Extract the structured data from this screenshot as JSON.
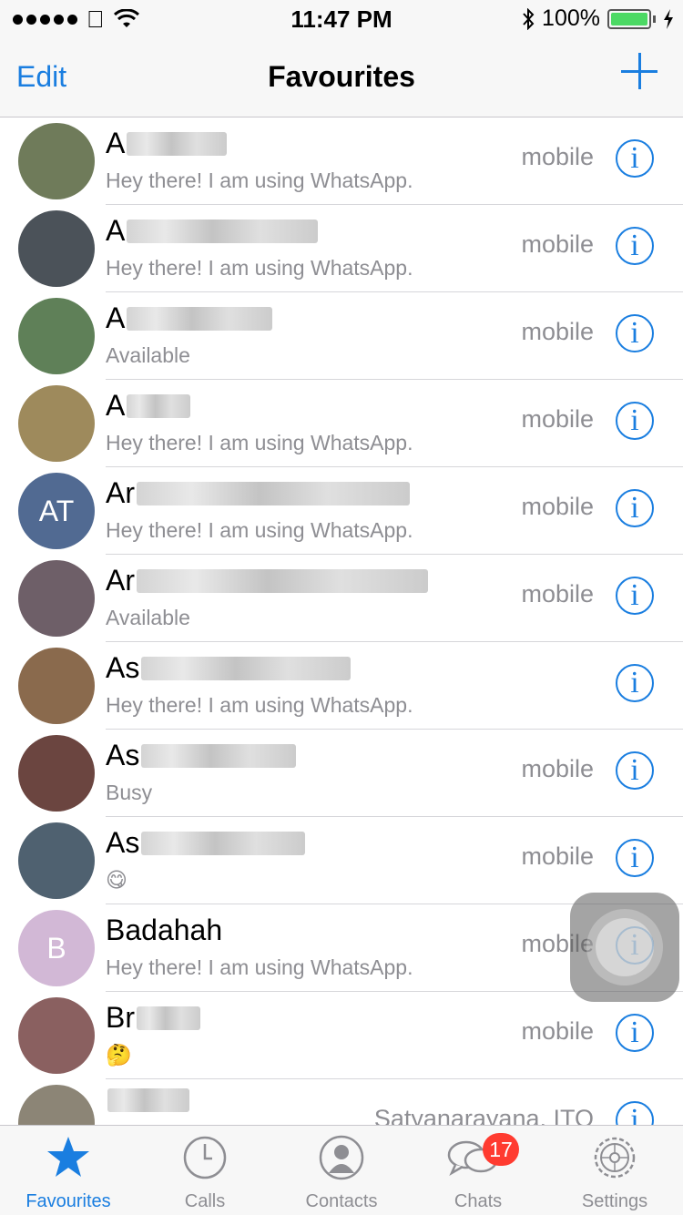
{
  "status_bar": {
    "time": "11:47 PM",
    "battery": "100%",
    "battery_level": 1.0,
    "signal_bars": 5
  },
  "nav": {
    "edit": "Edit",
    "title": "Favourites"
  },
  "contacts": [
    {
      "name": "A",
      "status": "Hey there! I am using WhatsApp.",
      "label": "mobile",
      "avatar_color": "#6f7b5a"
    },
    {
      "name": "A",
      "status": "Hey there! I am using WhatsApp.",
      "label": "mobile",
      "avatar_color": "#4b5259"
    },
    {
      "name": "A",
      "status": "Available",
      "label": "mobile",
      "avatar_color": "#5f8058"
    },
    {
      "name": "A",
      "status": "Hey there! I am using WhatsApp.",
      "label": "mobile",
      "avatar_color": "#9e8a5c"
    },
    {
      "name": "Ar",
      "status": "Hey there! I am using WhatsApp.",
      "label": "mobile",
      "avatar_text": "AT",
      "avatar_color": "#516a92"
    },
    {
      "name": "Ar",
      "status": "Available",
      "label": "mobile",
      "avatar_color": "#6e5f68"
    },
    {
      "name": "As",
      "status": "Hey there! I am using WhatsApp.",
      "label": "",
      "avatar_color": "#8a6a4d"
    },
    {
      "name": "As",
      "status": "Busy",
      "label": "mobile",
      "avatar_color": "#6b4540"
    },
    {
      "name": "As",
      "status": "😋",
      "label": "mobile",
      "avatar_color": "#4f6170"
    },
    {
      "name": "Badahah",
      "status": "Hey there! I am using WhatsApp.",
      "label": "mobile",
      "avatar_text": "B",
      "avatar_color": "#d2b8d6"
    },
    {
      "name": "Br",
      "status": "🤔",
      "label": "mobile",
      "avatar_color": "#8a6060"
    },
    {
      "name": "",
      "status": "",
      "label": "Satyanarayana, ITO",
      "avatar_color": "#8c8576"
    }
  ],
  "tabs": [
    {
      "label": "Favourites",
      "icon": "star-icon"
    },
    {
      "label": "Calls",
      "icon": "clock-icon"
    },
    {
      "label": "Contacts",
      "icon": "person-icon"
    },
    {
      "label": "Chats",
      "icon": "chat-bubbles-icon",
      "badge": "17"
    },
    {
      "label": "Settings",
      "icon": "gear-icon"
    }
  ],
  "colors": {
    "accent": "#1a7ee0",
    "badge": "#ff3b30"
  }
}
